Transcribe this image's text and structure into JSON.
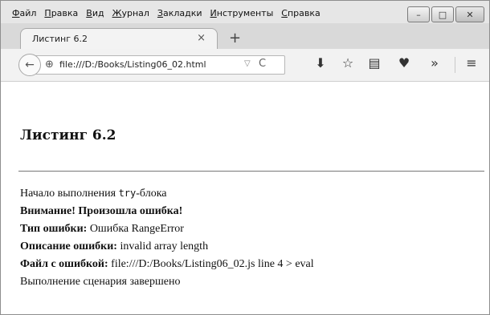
{
  "menu": [
    "Файл",
    "Правка",
    "Вид",
    "Журнал",
    "Закладки",
    "Инструменты",
    "Справка"
  ],
  "window_buttons": {
    "minimize": "–",
    "maximize": "□",
    "close": "✕"
  },
  "tab": {
    "title": "Листинг 6.2",
    "close": "×",
    "new_tab": "+"
  },
  "nav": {
    "back": "←",
    "url": "file:///D:/Books/Listing06_02.html",
    "dropdown": "▽",
    "reload": "C"
  },
  "toolbar": {
    "download_icon": "⬇",
    "bookmark_icon": "☆",
    "reader_icon": "▤",
    "pocket_icon": "♥",
    "overflow": "»",
    "menu_icon": "≡"
  },
  "page": {
    "heading": "Листинг 6.2",
    "line1_prefix": "Начало выполнения ",
    "line1_code": "try",
    "line1_suffix": "-блока",
    "line2": "Внимание! Произошла ошибка!",
    "line3_label": "Тип ошибки:",
    "line3_value": " Ошибка RangeError",
    "line4_label": "Описание ошибки:",
    "line4_value": " invalid array length",
    "line5_label": "Файл с ошибкой:",
    "line5_value": " file:///D:/Books/Listing06_02.js line 4 > eval",
    "line6": "Выполнение сценария завершено"
  }
}
